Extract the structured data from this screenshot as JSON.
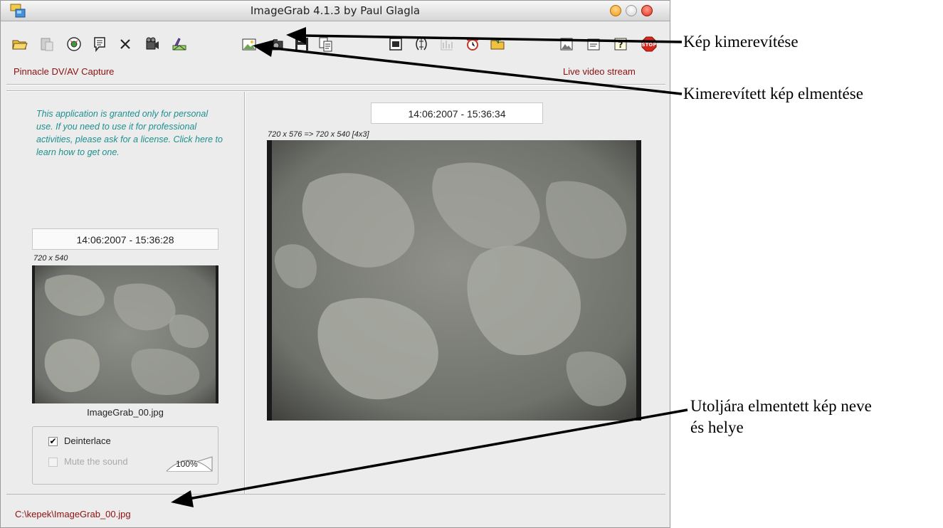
{
  "window": {
    "title": "ImageGrab 4.1.3 by Paul Glagla"
  },
  "toolbar": {
    "left_icons": [
      "open-folder-icon",
      "paste-icon",
      "camera-source-icon",
      "comment-icon",
      "delete-icon",
      "video-capture-icon",
      "image-settings-icon"
    ],
    "middle_icons": [
      "freeze-frame-icon",
      "snapshot-camera-icon",
      "save-disk-icon",
      "copy-icon"
    ],
    "right_icons": [
      "display-icon",
      "adjust-icon",
      "chart-icon",
      "alarm-clock-icon",
      "folder-open-icon"
    ],
    "far_icons": [
      "image-view-icon",
      "properties-icon",
      "help-icon",
      "stop-icon"
    ]
  },
  "header": {
    "device": "Pinnacle DV/AV Capture",
    "stream": "Live video stream"
  },
  "license_text": "This application is granted only for personal use. If you need to use it for professional activities, please ask for a license. Click here to learn how to get one.",
  "snapshot": {
    "timestamp": "14:06:2007 - 15:36:28",
    "resolution": "720 x 540",
    "filename": "ImageGrab_00.jpg"
  },
  "live": {
    "timestamp": "14:06:2007 - 15:36:34",
    "resolution": "720 x 576  =>  720 x 540 [4x3]"
  },
  "options": {
    "deinterlace_label": "Deinterlace",
    "deinterlace_checked": true,
    "mute_label": "Mute the sound",
    "mute_checked": false,
    "volume": "100%"
  },
  "status": {
    "path": "C:\\kepek\\ImageGrab_00.jpg"
  },
  "annotations": {
    "freeze": "Kép kimerevítése",
    "save": "Kimerevített kép elmentése",
    "last_saved_line1": "Utoljára elmentett kép neve",
    "last_saved_line2": "és helye"
  },
  "colors": {
    "header_text": "#8b1010",
    "license_text": "#1f8f8f",
    "window_bg": "#ececec"
  }
}
